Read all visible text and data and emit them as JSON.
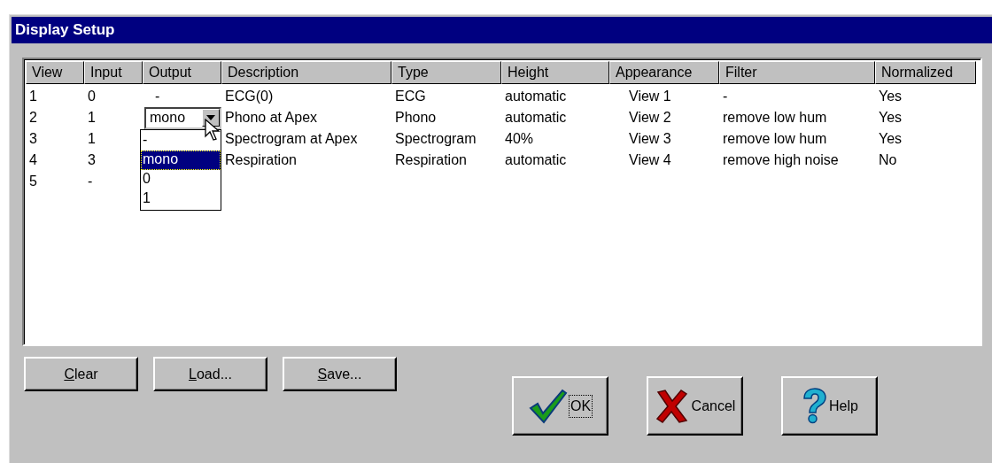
{
  "window": {
    "title": "Display Setup"
  },
  "table": {
    "columns": [
      "View",
      "Input",
      "Output",
      "Description",
      "Type",
      "Height",
      "Appearance",
      "Filter",
      "Normalized"
    ],
    "rows": [
      {
        "cells": [
          "1",
          "0",
          "-",
          "ECG(0)",
          "ECG",
          "automatic",
          "View 1",
          "-",
          "Yes"
        ]
      },
      {
        "cells": [
          "2",
          "1",
          {
            "kind": "combo",
            "value": "mono",
            "expanded": true,
            "options": [
              {
                "label": "-",
                "selected": false
              },
              {
                "label": "mono",
                "selected": true
              },
              {
                "label": "0",
                "selected": false
              },
              {
                "label": "1",
                "selected": false
              }
            ]
          },
          "Phono at Apex",
          "Phono",
          "automatic",
          "View 2",
          "remove low hum",
          "Yes"
        ]
      },
      {
        "cells": [
          "3",
          "1",
          "",
          "Spectrogram at Apex",
          "Spectrogram",
          "40%",
          "View 3",
          "remove low hum",
          "Yes"
        ]
      },
      {
        "cells": [
          "4",
          "3",
          "",
          "Respiration",
          "Respiration",
          "automatic",
          "View 4",
          "remove high noise",
          "No"
        ]
      },
      {
        "cells": [
          "5",
          "-"
        ]
      }
    ]
  },
  "buttons": [
    {
      "label": "Clear"
    },
    {
      "label": "Load..."
    },
    {
      "label": "Save..."
    }
  ],
  "dialog_buttons": [
    {
      "kind": "ok",
      "label": "OK",
      "focused": true
    },
    {
      "kind": "cancel",
      "label": "Cancel",
      "focused": false
    },
    {
      "kind": "help",
      "label": "Help",
      "focused": false
    }
  ]
}
